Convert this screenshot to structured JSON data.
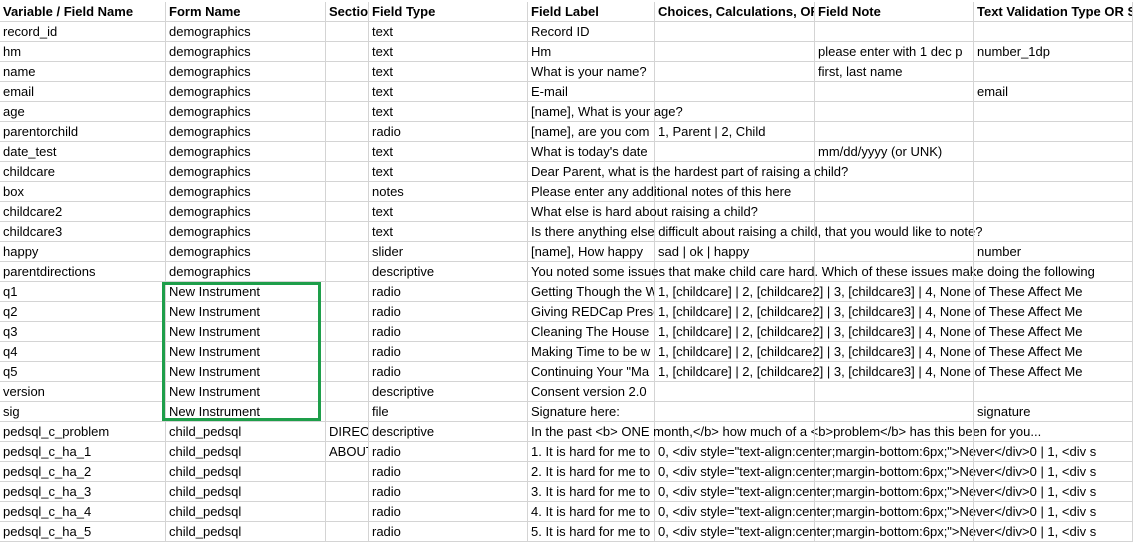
{
  "columns": [
    "Variable / Field Name",
    "Form Name",
    "Section Header",
    "Field Type",
    "Field Label",
    "Choices, Calculations, OR Slider Labels",
    "Field Note",
    "Text Validation Type OR Show Slider Number"
  ],
  "rows": [
    [
      "record_id",
      "demographics",
      "",
      "text",
      "Record ID",
      "",
      "",
      ""
    ],
    [
      "hm",
      "demographics",
      "",
      "text",
      "Hm",
      "",
      "please enter with 1 dec p",
      "number_1dp"
    ],
    [
      "name",
      "demographics",
      "",
      "text",
      "What is your name?",
      "",
      "first, last name",
      ""
    ],
    [
      "email",
      "demographics",
      "",
      "text",
      "E-mail",
      "",
      "",
      "email"
    ],
    [
      "age",
      "demographics",
      "",
      "text",
      "[name], What is your age?",
      "",
      "",
      ""
    ],
    [
      "parentorchild",
      "demographics",
      "",
      "radio",
      "[name], are you com",
      "1, Parent | 2, Child",
      "",
      ""
    ],
    [
      "date_test",
      "demographics",
      "",
      "text",
      "What is today's date",
      "",
      "mm/dd/yyyy (or UNK)",
      ""
    ],
    [
      "childcare",
      "demographics",
      "",
      "text",
      "Dear Parent, what is the hardest part of raising a child?",
      "",
      "",
      ""
    ],
    [
      "box",
      "demographics",
      "",
      "notes",
      "Please enter any additional notes of this here",
      "",
      "",
      ""
    ],
    [
      "childcare2",
      "demographics",
      "",
      "text",
      "What else is hard about raising a child?",
      "",
      "",
      ""
    ],
    [
      "childcare3",
      "demographics",
      "",
      "text",
      "Is there anything else difficult about raising a child, that you would like to note?",
      "",
      "",
      ""
    ],
    [
      "happy",
      "demographics",
      "",
      "slider",
      "[name],  How happy",
      "sad | ok | happy",
      "",
      "number"
    ],
    [
      "parentdirections",
      "demographics",
      "",
      "descriptive",
      "You noted some issues that make child care hard. Which of these issues make doing the following",
      "",
      "",
      ""
    ],
    [
      "q1",
      "New Instrument",
      "",
      "radio",
      "Getting Though the W",
      "1, [childcare] | 2, [childcare2] | 3, [childcare3] | 4, None of These Affect Me",
      "",
      ""
    ],
    [
      "q2",
      "New Instrument",
      "",
      "radio",
      "Giving REDCap Presentation",
      "1, [childcare] | 2, [childcare2] | 3, [childcare3] | 4, None of These Affect Me",
      "",
      ""
    ],
    [
      "q3",
      "New Instrument",
      "",
      "radio",
      "Cleaning The House",
      "1, [childcare] | 2, [childcare2] | 3, [childcare3] | 4, None of These Affect Me",
      "",
      ""
    ],
    [
      "q4",
      "New Instrument",
      "",
      "radio",
      "Making Time to be w",
      "1, [childcare] | 2, [childcare2] | 3, [childcare3] | 4, None of These Affect Me",
      "",
      ""
    ],
    [
      "q5",
      "New Instrument",
      "",
      "radio",
      "Continuing Your \"Ma",
      "1, [childcare] | 2, [childcare2] | 3, [childcare3] | 4, None of These Affect Me",
      "",
      ""
    ],
    [
      "version",
      "New Instrument",
      "",
      "descriptive",
      "Consent version  2.0",
      "",
      "",
      ""
    ],
    [
      "sig",
      "New Instrument",
      "",
      "file",
      "Signature here:",
      "",
      "",
      "signature"
    ],
    [
      "pedsql_c_problem",
      "child_pedsql",
      "DIRECT",
      "descriptive",
      "In the past <b> ONE month,</b> how much of a <b>problem</b> has this been for you...",
      "",
      "",
      ""
    ],
    [
      "pedsql_c_ha_1",
      "child_pedsql",
      "ABOUT",
      "radio",
      "1. It is hard for me to",
      "0, <div style=\"text-align:center;margin-bottom:6px;\">Never</div>0 | 1, <div s",
      "",
      ""
    ],
    [
      "pedsql_c_ha_2",
      "child_pedsql",
      "",
      "radio",
      "2. It is hard for me to",
      "0, <div style=\"text-align:center;margin-bottom:6px;\">Never</div>0 | 1, <div s",
      "",
      ""
    ],
    [
      "pedsql_c_ha_3",
      "child_pedsql",
      "",
      "radio",
      "3. It is hard for me to",
      "0, <div style=\"text-align:center;margin-bottom:6px;\">Never</div>0 | 1, <div s",
      "",
      ""
    ],
    [
      "pedsql_c_ha_4",
      "child_pedsql",
      "",
      "radio",
      "4. It is hard for me to",
      "0, <div style=\"text-align:center;margin-bottom:6px;\">Never</div>0 | 1, <div s",
      "",
      ""
    ],
    [
      "pedsql_c_ha_5",
      "child_pedsql",
      "",
      "radio",
      "5. It is hard for me to",
      "0, <div style=\"text-align:center;margin-bottom:6px;\">Never</div>0 | 1, <div s",
      "",
      ""
    ]
  ],
  "colors": {
    "grid": "#d4d4d4",
    "highlight": "#1e9e4a"
  }
}
